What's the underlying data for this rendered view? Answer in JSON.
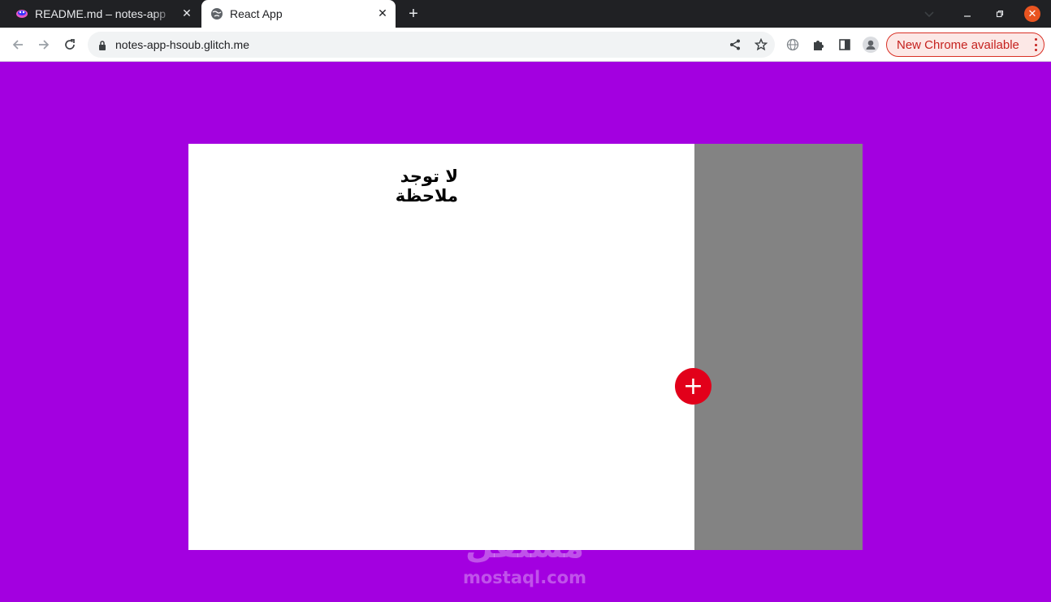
{
  "browser": {
    "tabs": [
      {
        "title": "README.md – notes-app",
        "active": false,
        "favicon": "glitch-favicon"
      },
      {
        "title": "React App",
        "active": true,
        "favicon": "globe-icon"
      }
    ],
    "url": "notes-app-hsoub.glitch.me",
    "update_label": "New Chrome available",
    "colors": {
      "update_accent": "#c5221f",
      "close_button": "#e95420"
    }
  },
  "app": {
    "empty_message": "لا توجد ملاحظة",
    "add_button_label": "+",
    "colors": {
      "background": "#a300e0",
      "list_bg": "#ffffff",
      "preview_bg": "#838383",
      "add_button": "#e2001a"
    }
  },
  "watermark": {
    "logo": "مستقل",
    "site": "mostaql.com"
  }
}
